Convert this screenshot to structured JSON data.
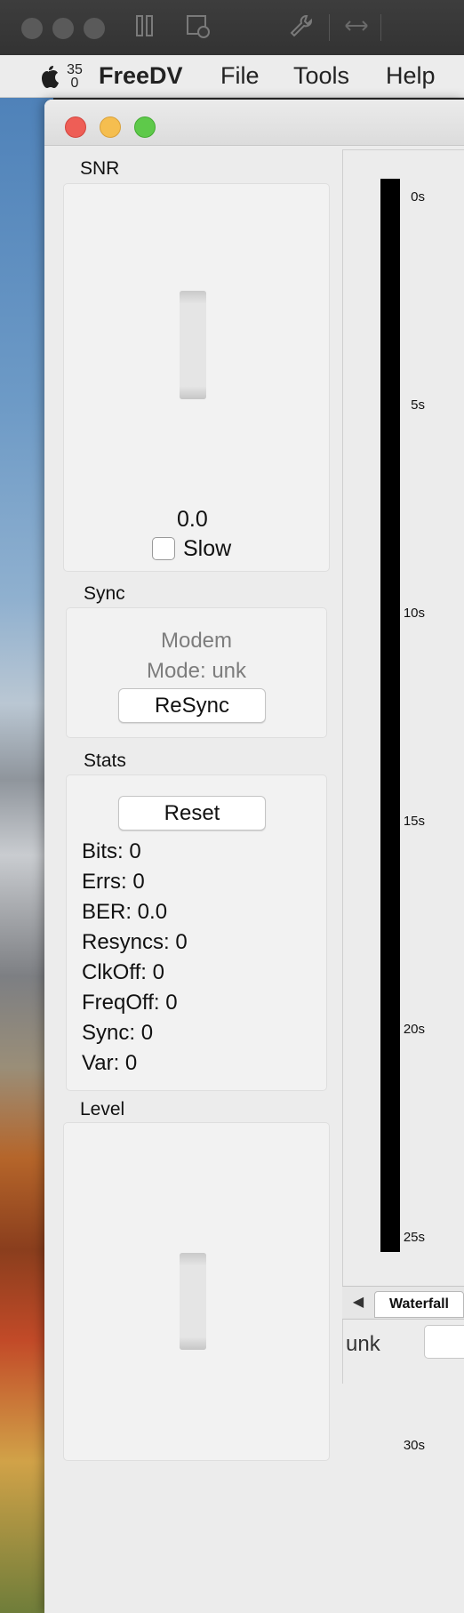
{
  "menubar": {
    "clock_top": "35",
    "clock_bottom": "0",
    "app_name": "FreeDV",
    "items": [
      "File",
      "Tools",
      "Help"
    ]
  },
  "snr": {
    "label": "SNR",
    "value": "0.0",
    "slow_label": "Slow",
    "slow_checked": false
  },
  "sync": {
    "label": "Sync",
    "modem_line1": "Modem",
    "modem_line2": "Mode: unk",
    "resync_label": "ReSync"
  },
  "stats": {
    "label": "Stats",
    "reset_label": "Reset",
    "lines": [
      "Bits: 0",
      "Errs: 0",
      "BER: 0.0",
      "Resyncs: 0",
      "ClkOff: 0",
      "FreqOff: 0",
      "Sync: 0",
      "Var: 0"
    ]
  },
  "level": {
    "label": "Level"
  },
  "plot": {
    "y_ticks": [
      "0s",
      "5s",
      "10s",
      "15s",
      "20s",
      "25s",
      "30s"
    ],
    "tab_label": "Waterfall",
    "plot_color": "#000000"
  },
  "status": {
    "mode_text": "unk"
  },
  "colors": {
    "close": "#ee5e56",
    "minimize": "#f5be4f",
    "maximize": "#5ec94a"
  }
}
